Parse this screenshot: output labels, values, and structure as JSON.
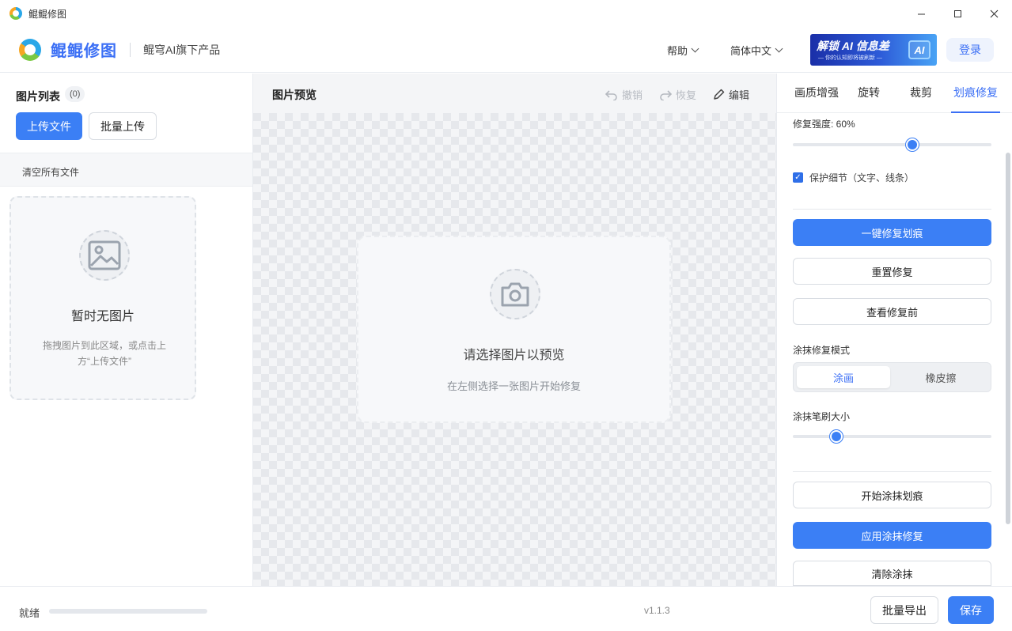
{
  "window": {
    "title": "鲲鲲修图"
  },
  "header": {
    "brand": "鲲鲲修图",
    "subtitle": "鲲穹AI旗下产品",
    "help": "帮助",
    "language": "简体中文",
    "banner_main": "解锁 AI 信息差",
    "banner_sub": "— 你的认知即将被刷新 —",
    "banner_badge": "AI",
    "login": "登录"
  },
  "left": {
    "list_title": "图片列表",
    "count": "(0)",
    "upload": "上传文件",
    "batch_upload": "批量上传",
    "clear_all": "清空所有文件",
    "empty_title": "暂时无图片",
    "empty_desc": "拖拽图片到此区域，或点击上方“上传文件”"
  },
  "center": {
    "title": "图片预览",
    "undo": "撤销",
    "redo": "恢复",
    "edit": "编辑",
    "placeholder_title": "请选择图片以预览",
    "placeholder_sub": "在左侧选择一张图片开始修复"
  },
  "right": {
    "tabs": [
      "画质增强",
      "旋转",
      "裁剪",
      "划痕修复"
    ],
    "active_tab": "划痕修复",
    "strength_label": "修复强度: 60%",
    "strength_value": 0.6,
    "protect_detail": "保护细节（文字、线条）",
    "protect_checked": true,
    "one_click": "一键修复划痕",
    "reset": "重置修复",
    "view_before": "查看修复前",
    "mode_label": "涂抹修复模式",
    "mode_paint": "涂画",
    "mode_eraser": "橡皮擦",
    "brush_label": "涂抹笔刷大小",
    "brush_value": 0.22,
    "start_smear": "开始涂抹划痕",
    "apply_smear": "应用涂抹修复",
    "clear_smear": "清除涂抹"
  },
  "footer": {
    "status": "就绪",
    "progress": 0,
    "version": "v1.1.3",
    "batch_export": "批量导出",
    "save": "保存"
  },
  "colors": {
    "accent": "#3b7ff5",
    "brand": "#3b6ff5"
  }
}
